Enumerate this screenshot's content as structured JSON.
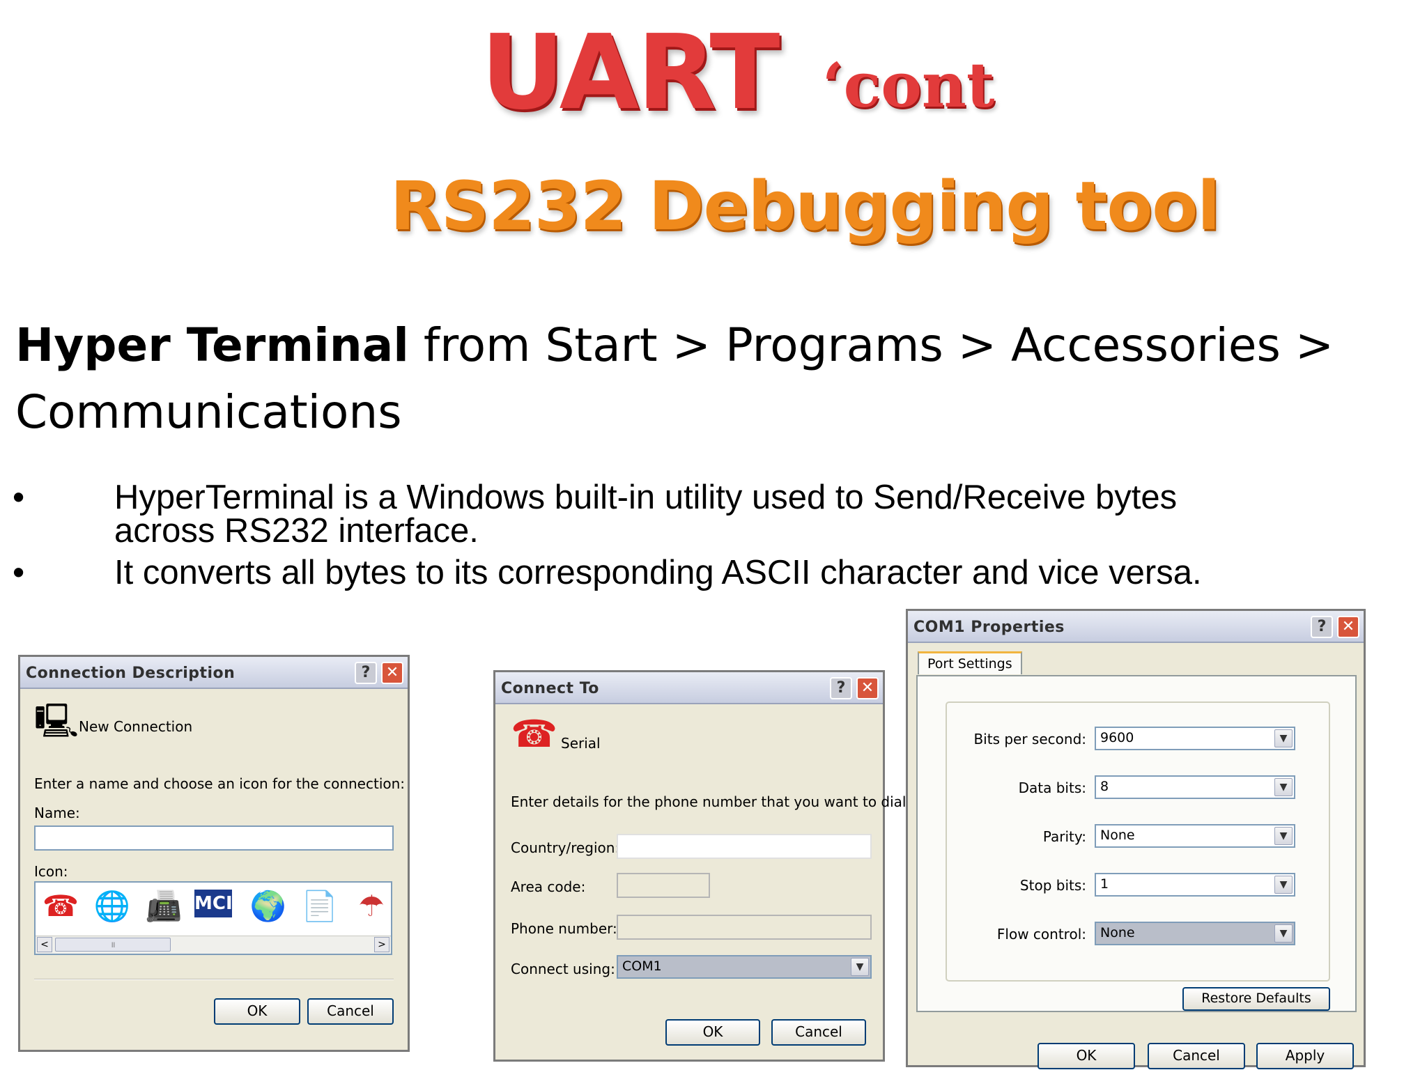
{
  "slide": {
    "title_main": "UART",
    "title_suffix": "‘cont",
    "subtitle": "RS232 Debugging tool",
    "path_bold": "Hyper Terminal",
    "path_rest": " from Start > Programs > Accessories > Communications",
    "bullets": [
      {
        "dot": "•",
        "text": "HyperTerminal is a Windows built-in utility used to Send/Receive bytes across RS232 interface."
      },
      {
        "dot": "•",
        "text": "It converts all bytes to its corresponding ASCII character and vice versa."
      }
    ]
  },
  "dialog_connection": {
    "title": "Connection Description",
    "help": "?",
    "close": "✕",
    "icon_caption": "New Connection",
    "prompt": "Enter a name and choose an icon for the connection:",
    "name_label": "Name:",
    "name_value": "",
    "icon_label": "Icon:",
    "scroll_left": "<",
    "scroll_thumb": "॥",
    "scroll_right": ">",
    "ok": "OK",
    "cancel": "Cancel"
  },
  "dialog_connect": {
    "title": "Connect To",
    "help": "?",
    "close": "✕",
    "icon_caption": "Serial",
    "prompt": "Enter details for the phone number that you want to dial:",
    "country_label": "Country/region:",
    "country_value": "",
    "area_label": "Area code:",
    "area_value": "",
    "phone_label": "Phone number:",
    "phone_value": "",
    "using_label": "Connect using:",
    "using_value": "COM1",
    "ok": "OK",
    "cancel": "Cancel"
  },
  "dialog_com": {
    "title": "COM1 Properties",
    "help": "?",
    "close": "✕",
    "tab": "Port Settings",
    "fields": [
      {
        "label": "Bits per second:",
        "value": "9600"
      },
      {
        "label": "Data bits:",
        "value": "8"
      },
      {
        "label": "Parity:",
        "value": "None"
      },
      {
        "label": "Stop bits:",
        "value": "1"
      },
      {
        "label": "Flow control:",
        "value": "None"
      }
    ],
    "restore": "Restore Defaults",
    "ok": "OK",
    "cancel": "Cancel",
    "apply": "Apply"
  },
  "icons": {
    "dropdown": "▼",
    "connection_icon": "🖳",
    "serial_icon": "☎",
    "strip": [
      "☎",
      "🌐",
      "📠",
      "MCI",
      "🌍",
      "📄",
      "☂"
    ]
  }
}
